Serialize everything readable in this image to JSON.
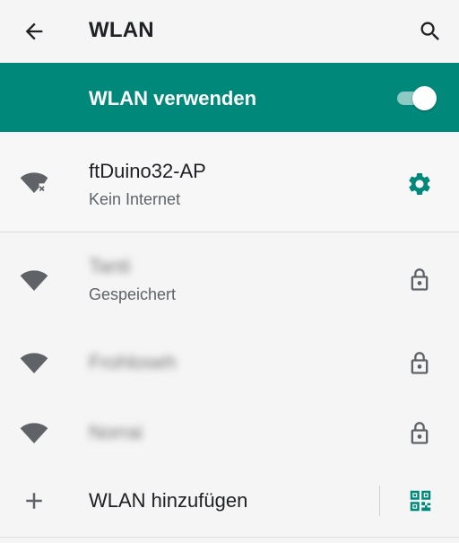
{
  "appbar": {
    "title": "WLAN"
  },
  "master": {
    "label": "WLAN verwenden",
    "enabled": true
  },
  "connected": {
    "name": "ftDuino32-AP",
    "status": "Kein Internet"
  },
  "saved_networks": [
    {
      "name": "Tanti",
      "status": "Gespeichert"
    },
    {
      "name": "Frohloseh",
      "status": ""
    },
    {
      "name": "Norrai",
      "status": ""
    }
  ],
  "add_network": {
    "label": "WLAN hinzufügen"
  },
  "colors": {
    "accent": "#00897b",
    "background": "#f5f5f5",
    "icon": "#5f6368"
  },
  "icons": {
    "back": "arrow-left",
    "search": "magnifier",
    "no_internet": "wifi-x",
    "settings": "gear",
    "wifi": "wifi",
    "lock": "padlock",
    "add": "plus",
    "qr": "qr-code"
  }
}
